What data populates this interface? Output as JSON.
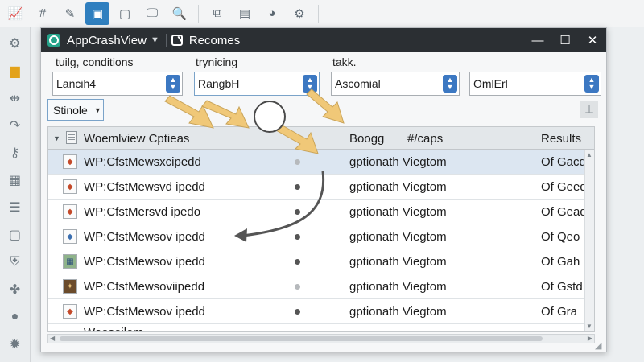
{
  "window": {
    "title": "AppCrashView",
    "subtitle": "Recomes"
  },
  "filters": {
    "labels": [
      "tuilg, conditions",
      "trynicing",
      "takk."
    ],
    "values": [
      "Lancih4",
      "RangbH",
      "Ascomial",
      "OmlErl"
    ]
  },
  "buttons": {
    "single": "Stinole"
  },
  "table": {
    "columns": [
      "Woemlview Cptieas",
      "Boogg",
      "#/caps",
      "Results"
    ],
    "rows": [
      {
        "name": "WP:CfstMewsxcipedd",
        "desc": "gptionath Viegtom",
        "result": "Of Gacd"
      },
      {
        "name": "WP:CfstMewsvd ipedd",
        "desc": "gptionath Viegtom",
        "result": "Of Geed"
      },
      {
        "name": "WP:CfstMersvd ipedo",
        "desc": "gptionath Viegtom",
        "result": "Of Gead"
      },
      {
        "name": "WP:CfstMewsov ipedd",
        "desc": "gptionath Viegtom",
        "result": "Of Qeo"
      },
      {
        "name": "WP:CfstMewsov ipedd",
        "desc": "gptionath Viegtom",
        "result": "Of Gah"
      },
      {
        "name": "WP:CfstMewsoviipedd",
        "desc": "gptionath Viegtom",
        "result": "Of Gstd"
      },
      {
        "name": "WP:CfstMewsov ipedd",
        "desc": "gptionath Viegtom",
        "result": "Of Gra"
      },
      {
        "name": "Weoseilem",
        "desc": "",
        "result": ""
      }
    ]
  },
  "icons": {
    "toolbar": [
      "chart-icon",
      "grid-icon",
      "edit-icon",
      "page-icon",
      "frame-icon",
      "monitor-icon",
      "search-icon",
      "copy-icon",
      "doc-icon",
      "chart-pie-icon",
      "settings-icon"
    ],
    "rail": [
      "gear-icon",
      "folder-icon",
      "split-icon",
      "redo-icon",
      "key-icon",
      "save-icon",
      "list-icon",
      "doc-icon",
      "shield-icon",
      "help-icon",
      "circle-icon",
      "gear-icon"
    ]
  },
  "colors": {
    "accent": "#3c78c2",
    "selection": "#dce6f1",
    "titlebar": "#2b2f33",
    "arrows": "#f0c878"
  }
}
